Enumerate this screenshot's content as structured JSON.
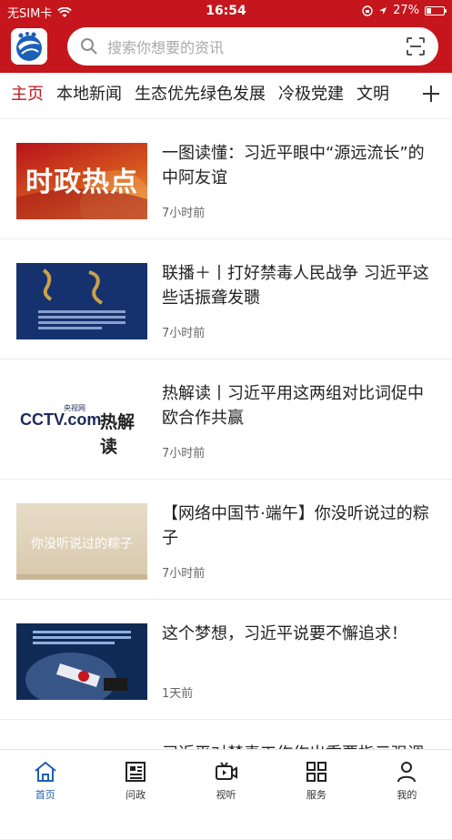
{
  "status_bar": {
    "carrier": "无SIM卡",
    "time": "16:54",
    "battery": "27%",
    "battery_level": 0.27
  },
  "header": {
    "logo_icon": "app-logo-icon",
    "search_placeholder": "搜索你想要的资讯",
    "scan_icon": "scan-icon"
  },
  "tabs": [
    {
      "label": "主页",
      "active": true
    },
    {
      "label": "本地新闻",
      "active": false
    },
    {
      "label": "生态优先绿色发展",
      "active": false
    },
    {
      "label": "冷极党建",
      "active": false
    },
    {
      "label": "文明",
      "active": false
    }
  ],
  "feed": [
    {
      "title": "一图读懂：习近平眼中“源远流长”的中阿友谊",
      "time": "7小时前",
      "thumb_text": "时政热点"
    },
    {
      "title": "联播＋丨打好禁毒人民战争 习近平这些话振聋发聩",
      "time": "7小时前",
      "thumb_text": ""
    },
    {
      "title": "热解读丨习近平用这两组对比词促中欧合作共赢",
      "time": "7小时前",
      "thumb_text": "热解读",
      "thumb_brand": "CCTV.com",
      "thumb_brand_sub": "央视网"
    },
    {
      "title": "【网络中国节·端午】你没听说过的粽子",
      "time": "7小时前",
      "thumb_text": "你没听说过的粽子"
    },
    {
      "title": "这个梦想，习近平说要不懈追求！",
      "time": "1天前",
      "thumb_text": ""
    },
    {
      "title": "习近平对禁毒工作作出重要指示强调",
      "time": "",
      "thumb_text": ""
    }
  ],
  "tabbar": [
    {
      "label": "首页",
      "icon": "home-icon",
      "active": true
    },
    {
      "label": "问政",
      "icon": "news-icon",
      "active": false
    },
    {
      "label": "视听",
      "icon": "video-icon",
      "active": false
    },
    {
      "label": "服务",
      "icon": "grid-icon",
      "active": false
    },
    {
      "label": "我的",
      "icon": "user-icon",
      "active": false
    }
  ],
  "colors": {
    "brand_red": "#c4161c",
    "active_blue": "#1f5fb3"
  }
}
